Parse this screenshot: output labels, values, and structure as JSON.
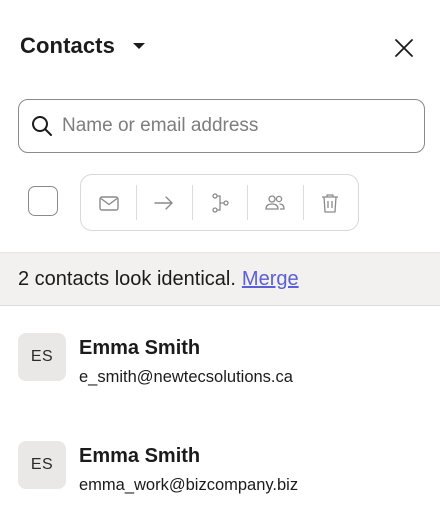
{
  "header": {
    "title": "Contacts",
    "dropdown_icon": "caret-down-icon",
    "close_icon": "close-icon"
  },
  "search": {
    "placeholder": "Name or email address",
    "value": "",
    "icon": "search-icon"
  },
  "toolbar": {
    "select_all_checked": false,
    "actions": [
      {
        "name": "email",
        "icon": "mail-icon"
      },
      {
        "name": "move",
        "icon": "arrow-right-icon"
      },
      {
        "name": "connect",
        "icon": "branch-icon"
      },
      {
        "name": "group",
        "icon": "users-icon"
      },
      {
        "name": "delete",
        "icon": "trash-icon"
      }
    ]
  },
  "banner": {
    "message": "2 contacts look identical.",
    "link": "Merge"
  },
  "contacts": [
    {
      "initials": "ES",
      "name": "Emma Smith",
      "email": "e_smith@newtecsolutions.ca"
    },
    {
      "initials": "ES",
      "name": "Emma Smith",
      "email": "emma_work@bizcompany.biz"
    }
  ],
  "colors": {
    "link": "#5b5fd6",
    "banner_bg": "#f2f1ef",
    "avatar_bg": "#e9e8e6",
    "icon_gray": "#8a8a8a"
  }
}
